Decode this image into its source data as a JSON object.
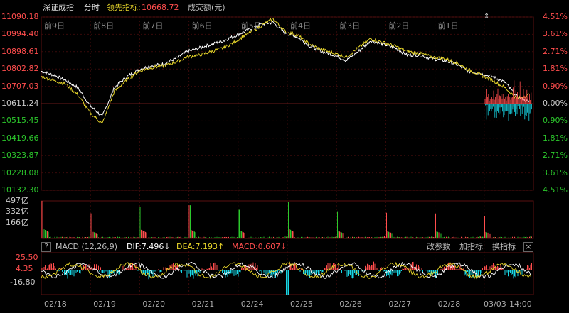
{
  "header": {
    "index_name": "深证成指",
    "mode": "分时",
    "leader_label": "领先指标:",
    "leader_value": "10668.72",
    "volume_label": "成交额(元)"
  },
  "colors": {
    "up": "#ff4d4d",
    "down": "#2cc82c",
    "white_line": "#ffffff",
    "yellow_line": "#e8d62a",
    "cyan": "#18d7e6",
    "grid": "#3a0a0a"
  },
  "price_axis": [
    "11090.18",
    "10994.40",
    "10898.61",
    "10802.82",
    "10707.03",
    "10611.24",
    "10515.45",
    "10419.66",
    "10323.87",
    "10228.08",
    "10132.30"
  ],
  "pct_axis": [
    "4.51%",
    "3.61%",
    "2.71%",
    "1.81%",
    "0.90%",
    "0.00%",
    "0.90%",
    "1.81%",
    "2.71%",
    "3.61%",
    "4.51%"
  ],
  "day_labels": [
    "前9日",
    "前8日",
    "前7日",
    "前6日",
    "前5日",
    "前4日",
    "前3日",
    "前2日",
    "前1日"
  ],
  "volume_axis": [
    "497亿",
    "332亿",
    "166亿"
  ],
  "macd": {
    "help_btn": "?",
    "name": "MACD (12,26,9)",
    "dif": "DIF:7.496↓",
    "dea": "DEA:7.193↑",
    "macd_val": "MACD:0.607↓",
    "change_params": "改参数",
    "add_indicator": "加指标",
    "switch_indicator": "换指标",
    "close": "×",
    "axis": [
      "25.50",
      "4.35",
      "-16.80"
    ]
  },
  "dates": [
    "02/18",
    "02/19",
    "02/20",
    "02/21",
    "02/24",
    "02/25",
    "02/26",
    "02/27",
    "02/28",
    "03/03",
    "14:00"
  ],
  "chart_data": {
    "type": "line",
    "price_range": [
      10132.3,
      11090.18
    ],
    "base": 10611.24,
    "series": [
      {
        "values": [
          10790,
          10770,
          10740,
          10700,
          10600,
          10540,
          10700,
          10760,
          10800,
          10820,
          10830,
          10860,
          10900,
          10920,
          10940,
          10960,
          10990,
          11020,
          11050,
          11060,
          11000,
          10980,
          10930,
          10900,
          10880,
          10850,
          10900,
          10960,
          10940,
          10920,
          10880,
          10880,
          10860,
          10850,
          10830,
          10790,
          10780,
          10760,
          10730,
          10650,
          10620
        ]
      },
      {
        "values": [
          10760,
          10740,
          10720,
          10660,
          10560,
          10500,
          10680,
          10740,
          10790,
          10810,
          10820,
          10840,
          10870,
          10880,
          10900,
          10920,
          10960,
          11000,
          11040,
          11080,
          11010,
          10990,
          10940,
          10910,
          10890,
          10870,
          10920,
          10970,
          10950,
          10930,
          10900,
          10890,
          10870,
          10860,
          10840,
          10800,
          10770,
          10740,
          10700,
          10640,
          10660
        ]
      }
    ],
    "volume_peaks": [
      497,
      332,
      420,
      440,
      380,
      480,
      360,
      340,
      330,
      300,
      120
    ]
  }
}
